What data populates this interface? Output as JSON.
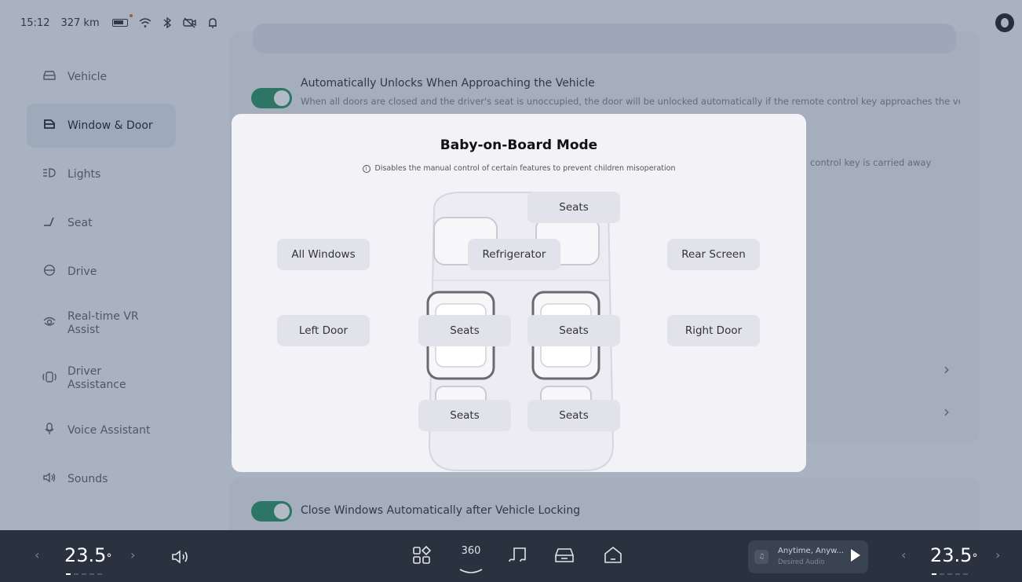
{
  "status": {
    "time": "15:12",
    "range": "327 km",
    "icons": [
      "battery-icon",
      "wifi-icon",
      "bluetooth-icon",
      "camera-off-icon",
      "bell-icon"
    ]
  },
  "sidebar": {
    "items": [
      {
        "label": "Vehicle",
        "icon": "car-icon",
        "active": false
      },
      {
        "label": "Window & Door",
        "icon": "door-icon",
        "active": true
      },
      {
        "label": "Lights",
        "icon": "lights-icon",
        "active": false
      },
      {
        "label": "Seat",
        "icon": "seat-icon",
        "active": false
      },
      {
        "label": "Drive",
        "icon": "steering-icon",
        "active": false
      },
      {
        "label": "Real-time VR Assist",
        "icon": "vr-assist-icon",
        "active": false
      },
      {
        "label": "Driver Assistance",
        "icon": "driver-assist-icon",
        "active": false
      },
      {
        "label": "Voice Assistant",
        "icon": "microphone-icon",
        "active": false
      },
      {
        "label": "Sounds",
        "icon": "speaker-icon",
        "active": false
      }
    ]
  },
  "settings": {
    "auto_unlock": {
      "title": "Automatically Unlocks When Approaching the Vehicle",
      "desc": "When all doors are closed and the driver's seat is unoccupied, the door will be unlocked automatically if the remote control key approaches the vehicle",
      "enabled": true
    },
    "partial_desc": "control key is carried away",
    "close_windows": {
      "title": "Close Windows Automatically after Vehicle Locking",
      "enabled": true
    }
  },
  "modal": {
    "title": "Baby-on-Board Mode",
    "subtitle": "Disables the manual control of certain features to prevent children misoperation",
    "info_icon": "info-icon",
    "buttons": {
      "all_windows": "All Windows",
      "left_door": "Left Door",
      "rear_screen": "Rear Screen",
      "right_door": "Right Door",
      "refrigerator": "Refrigerator",
      "seats_front": "Seats",
      "seats_mid_left": "Seats",
      "seats_mid_right": "Seats",
      "seats_rear_left": "Seats",
      "seats_rear_right": "Seats"
    }
  },
  "bottombar": {
    "temp_left": "23.5",
    "temp_right": "23.5",
    "temp_unit": "°",
    "nav_360": "360",
    "media_title": "Anytime, Anyw...",
    "media_subtitle": "Desired Audio"
  },
  "colors": {
    "toggle_on": "#1c8a5a",
    "overlay": "#465a78",
    "bottom_bar": "#2a3240"
  }
}
